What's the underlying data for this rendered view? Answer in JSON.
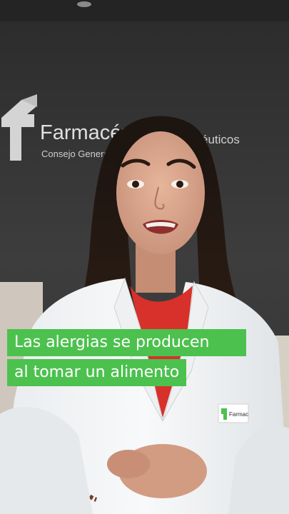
{
  "background": {
    "logo_text": "Farmacéuticos",
    "logo_subtitle_left": "Consejo General",
    "logo_subtitle_right": "éuticos",
    "coat_badge_text": "Farmac"
  },
  "caption": {
    "line1": "Las alergias se producen",
    "line2": "al tomar un alimento"
  },
  "colors": {
    "caption_bg": "#4cc14e",
    "caption_text": "#ffffff",
    "wall": "#3a3a3a",
    "shirt": "#d8302a"
  }
}
